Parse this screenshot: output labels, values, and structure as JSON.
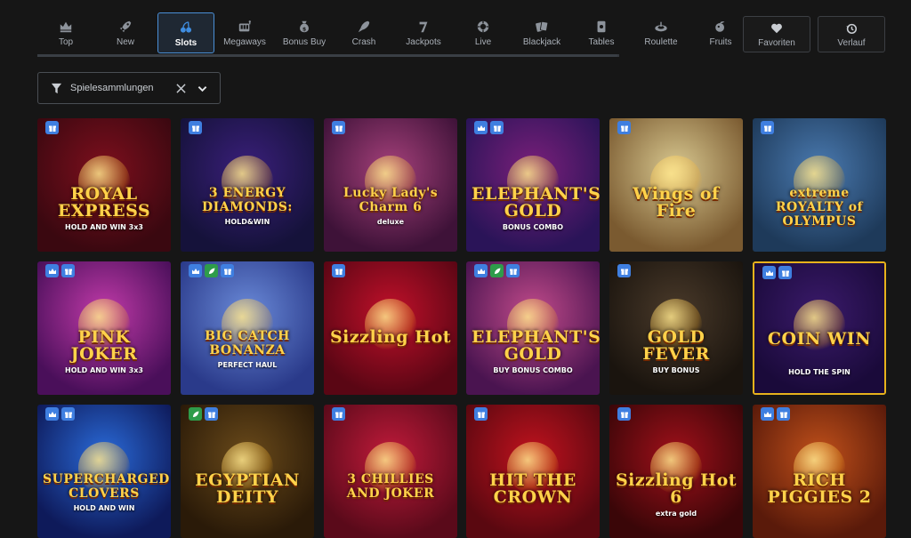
{
  "nav": {
    "items": [
      {
        "label": "Top",
        "icon": "crown-icon"
      },
      {
        "label": "New",
        "icon": "rocket-icon"
      },
      {
        "label": "Slots",
        "icon": "cherries-icon",
        "active": true
      },
      {
        "label": "Megaways",
        "icon": "slot-machine-icon"
      },
      {
        "label": "Bonus Buy",
        "icon": "money-bag-icon"
      },
      {
        "label": "Crash",
        "icon": "rocket-launch-icon"
      },
      {
        "label": "Jackpots",
        "icon": "seven-icon"
      },
      {
        "label": "Live",
        "icon": "roulette-chip-icon"
      },
      {
        "label": "Blackjack",
        "icon": "cards-icon"
      },
      {
        "label": "Tables",
        "icon": "card-table-icon"
      },
      {
        "label": "Roulette",
        "icon": "roulette-wheel-icon"
      },
      {
        "label": "Fruits",
        "icon": "fruits-icon"
      }
    ],
    "favorites_label": "Favoriten",
    "history_label": "Verlauf"
  },
  "filter": {
    "label": "Spielesammlungen"
  },
  "games": [
    {
      "title": "ROYAL EXPRESS",
      "subtitle": "HOLD AND WIN 3x3",
      "badges": [
        "gift"
      ],
      "colors": [
        "#7d0f1d",
        "#3a0810"
      ]
    },
    {
      "title": "3 ENERGY DIAMONDS:",
      "subtitle": "HOLD&WIN",
      "badges": [
        "gift"
      ],
      "colors": [
        "#3a1f7a",
        "#15123a"
      ]
    },
    {
      "title": "Lucky Lady's Charm 6",
      "subtitle": "deluxe",
      "badges": [
        "gift"
      ],
      "colors": [
        "#a4407a",
        "#3e1238"
      ]
    },
    {
      "title": "ELEPHANT'S GOLD",
      "subtitle": "BONUS COMBO",
      "badges": [
        "crown",
        "gift"
      ],
      "colors": [
        "#7a1f7a",
        "#2a1458"
      ]
    },
    {
      "title": "Wings of Fire",
      "subtitle": "",
      "badges": [
        "gift"
      ],
      "colors": [
        "#d8c890",
        "#7a5a30"
      ]
    },
    {
      "title": "extreme ROYALTY of OLYMPUS",
      "subtitle": "",
      "badges": [
        "gift"
      ],
      "colors": [
        "#4a7ab0",
        "#1e3a5a"
      ]
    },
    {
      "title": "PINK JOKER",
      "subtitle": "HOLD AND WIN 3x3",
      "badges": [
        "crown",
        "gift"
      ],
      "colors": [
        "#c03aa8",
        "#4a0f5a"
      ]
    },
    {
      "title": "BIG CATCH BONANZA",
      "subtitle": "PERFECT HAUL",
      "badges": [
        "crown",
        "leaf",
        "gift"
      ],
      "colors": [
        "#6a8ad8",
        "#2a3a8a"
      ]
    },
    {
      "title": "Sizzling Hot",
      "subtitle": "",
      "badges": [
        "gift"
      ],
      "colors": [
        "#c0102a",
        "#5a0614"
      ]
    },
    {
      "title": "ELEPHANT'S GOLD",
      "subtitle": "BUY BONUS COMBO",
      "badges": [
        "crown",
        "leaf",
        "gift"
      ],
      "colors": [
        "#c04a8a",
        "#4a1450"
      ]
    },
    {
      "title": "GOLD FEVER",
      "subtitle": "BUY BONUS",
      "badges": [
        "gift"
      ],
      "colors": [
        "#4a3a2a",
        "#1a140e"
      ]
    },
    {
      "title": "COIN WIN",
      "subtitle": "HOLD THE SPIN",
      "badges": [
        "crown",
        "gift"
      ],
      "colors": [
        "#3a1a6a",
        "#1a0a3a"
      ],
      "selected": true
    },
    {
      "title": "SUPERCHARGED CLOVERS",
      "subtitle": "HOLD AND WIN",
      "badges": [
        "crown",
        "gift"
      ],
      "colors": [
        "#2a6ad8",
        "#0e1a5a"
      ]
    },
    {
      "title": "EGYPTIAN DEITY",
      "subtitle": "",
      "badges": [
        "leaf",
        "gift"
      ],
      "colors": [
        "#6a4a1a",
        "#2a1a08"
      ]
    },
    {
      "title": "3 CHILLIES AND JOKER",
      "subtitle": "",
      "badges": [
        "gift"
      ],
      "colors": [
        "#c01a3a",
        "#5a0a1a"
      ]
    },
    {
      "title": "HIT THE CROWN",
      "subtitle": "",
      "badges": [
        "gift"
      ],
      "colors": [
        "#c0121e",
        "#5a0810"
      ]
    },
    {
      "title": "Sizzling Hot 6",
      "subtitle": "extra gold",
      "badges": [
        "gift"
      ],
      "colors": [
        "#a0101a",
        "#3a0608"
      ]
    },
    {
      "title": "RICH PIGGIES 2",
      "subtitle": "",
      "badges": [
        "crown",
        "gift"
      ],
      "colors": [
        "#c0501a",
        "#5a1a0a"
      ]
    }
  ]
}
